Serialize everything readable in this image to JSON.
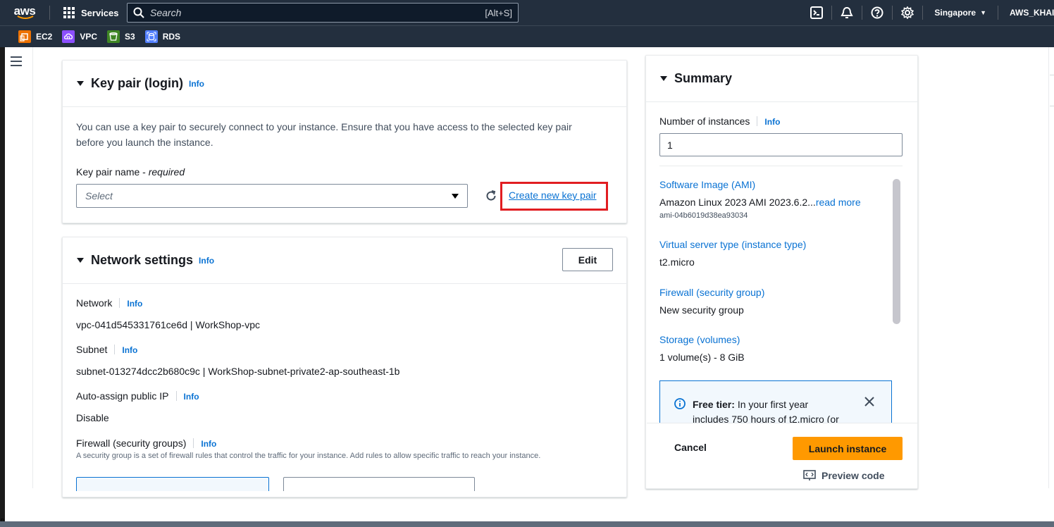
{
  "nav": {
    "logo_text": "aws",
    "services_label": "Services",
    "search_placeholder": "Search",
    "search_shortcut": "[Alt+S]",
    "region": "Singapore",
    "account": "AWS_KHAI"
  },
  "favorites": [
    {
      "label": "EC2",
      "color": "#ed7100"
    },
    {
      "label": "VPC",
      "color": "#8c4fff"
    },
    {
      "label": "S3",
      "color": "#3f8624"
    },
    {
      "label": "RDS",
      "color": "#527fff"
    }
  ],
  "key_pair": {
    "title": "Key pair (login)",
    "info": "Info",
    "description": "You can use a key pair to securely connect to your instance. Ensure that you have access to the selected key pair before you launch the instance.",
    "name_label": "Key pair name",
    "required": "required",
    "select_placeholder": "Select",
    "create_link": "Create new key pair"
  },
  "network": {
    "title": "Network settings",
    "info": "Info",
    "edit": "Edit",
    "network_label": "Network",
    "network_value": "vpc-041d545331761ce6d | WorkShop-vpc",
    "subnet_label": "Subnet",
    "subnet_value": "subnet-013274dcc2b680c9c | WorkShop-subnet-private2-ap-southeast-1b",
    "public_ip_label": "Auto-assign public IP",
    "public_ip_value": "Disable",
    "firewall_label": "Firewall (security groups)",
    "firewall_desc": "A security group is a set of firewall rules that control the traffic for your instance. Add rules to allow specific traffic to reach your instance."
  },
  "summary": {
    "title": "Summary",
    "instances_label": "Number of instances",
    "info": "Info",
    "instances_value": "1",
    "ami_label": "Software Image (AMI)",
    "ami_value": "Amazon Linux 2023 AMI 2023.6.2...",
    "read_more": "read more",
    "ami_id": "ami-04b6019d38ea93034",
    "instance_type_label": "Virtual server type (instance type)",
    "instance_type_value": "t2.micro",
    "firewall_label": "Firewall (security group)",
    "firewall_value": "New security group",
    "storage_label": "Storage (volumes)",
    "storage_value": "1 volume(s) - 8 GiB",
    "free_tier_bold": "Free tier:",
    "free_tier_text": "In your first year",
    "free_tier_cut": "includes 750 hours of t2.micro (or",
    "cancel": "Cancel",
    "launch": "Launch instance",
    "preview": "Preview code"
  }
}
